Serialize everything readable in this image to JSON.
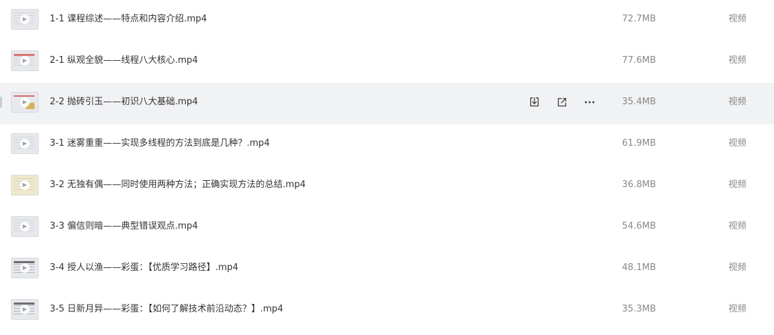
{
  "files": [
    {
      "name": "1-1 课程综述——特点和内容介绍.mp4",
      "size": "72.7MB",
      "type": "视频",
      "thumb": "plain",
      "hovered": false
    },
    {
      "name": "2-1 纵观全貌——线程八大核心.mp4",
      "size": "77.6MB",
      "type": "视频",
      "thumb": "accent",
      "hovered": false
    },
    {
      "name": "2-2 抛砖引玉——初识八大基础.mp4",
      "size": "35.4MB",
      "type": "视频",
      "thumb": "gold",
      "hovered": true
    },
    {
      "name": "3-1 迷雾重重——实现多线程的方法到底是几种？.mp4",
      "size": "61.9MB",
      "type": "视频",
      "thumb": "plain",
      "hovered": false
    },
    {
      "name": "3-2 无独有偶——同时使用两种方法；正确实现方法的总结.mp4",
      "size": "36.8MB",
      "type": "视频",
      "thumb": "yellow",
      "hovered": false
    },
    {
      "name": "3-3 偏信则暗——典型错误观点.mp4",
      "size": "54.6MB",
      "type": "视频",
      "thumb": "plain",
      "hovered": false
    },
    {
      "name": "3-4 授人以渔——彩蛋：【优质学习路径】.mp4",
      "size": "48.1MB",
      "type": "视频",
      "thumb": "dark",
      "hovered": false
    },
    {
      "name": "3-5 日新月异——彩蛋：【如何了解技术前沿动态？】.mp4",
      "size": "35.3MB",
      "type": "视频",
      "thumb": "dark",
      "hovered": false
    }
  ],
  "row_actions": {
    "icons": [
      "download-icon",
      "share-icon",
      "more-icon"
    ]
  },
  "colors": {
    "hover_bg": "#f1f2f4",
    "text_primary": "#333333",
    "text_secondary": "#888888"
  }
}
